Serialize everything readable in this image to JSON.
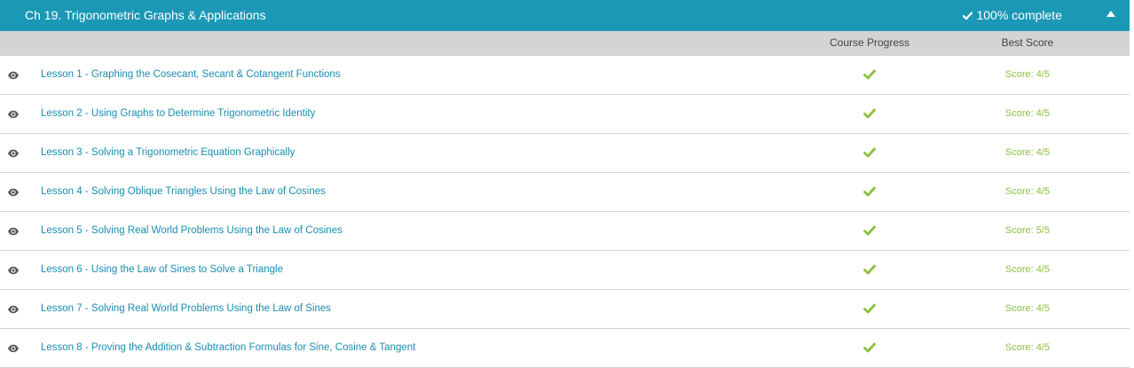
{
  "chapter": {
    "title": "Ch 19. Trigonometric Graphs & Applications",
    "completion": "100% complete",
    "accent_color": "#1a98b5"
  },
  "columns": {
    "progress": "Course Progress",
    "score": "Best Score"
  },
  "status_color": "#8dc03e",
  "lessons": [
    {
      "title": "Lesson 1 - Graphing the Cosecant, Secant & Cotangent Functions",
      "progress": "complete",
      "score": "Score: 4/5"
    },
    {
      "title": "Lesson 2 - Using Graphs to Determine Trigonometric Identity",
      "progress": "complete",
      "score": "Score: 4/5"
    },
    {
      "title": "Lesson 3 - Solving a Trigonometric Equation Graphically",
      "progress": "complete",
      "score": "Score: 4/5"
    },
    {
      "title": "Lesson 4 - Solving Oblique Triangles Using the Law of Cosines",
      "progress": "complete",
      "score": "Score: 4/5"
    },
    {
      "title": "Lesson 5 - Solving Real World Problems Using the Law of Cosines",
      "progress": "complete",
      "score": "Score: 5/5"
    },
    {
      "title": "Lesson 6 - Using the Law of Sines to Solve a Triangle",
      "progress": "complete",
      "score": "Score: 4/5"
    },
    {
      "title": "Lesson 7 - Solving Real World Problems Using the Law of Sines",
      "progress": "complete",
      "score": "Score: 4/5"
    },
    {
      "title": "Lesson 8 - Proving the Addition & Subtraction Formulas for Sine, Cosine & Tangent",
      "progress": "complete",
      "score": "Score: 4/5"
    }
  ]
}
